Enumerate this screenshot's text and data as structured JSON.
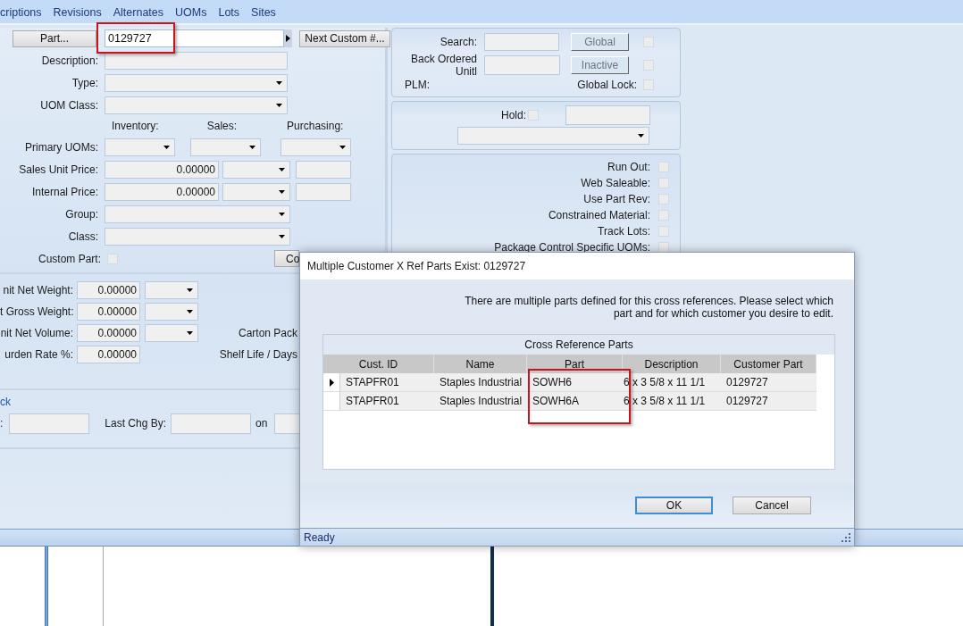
{
  "menu_tabs": [
    "criptions",
    "Revisions",
    "Alternates",
    "UOMs",
    "Lots",
    "Sites"
  ],
  "part_form": {
    "part_button": "Part...",
    "part_number": "0129727",
    "next_button": "Next Custom #...",
    "description_label": "Description:",
    "type_label": "Type:",
    "uom_class_label": "UOM Class:",
    "uom_headers": [
      "Inventory:",
      "Sales:",
      "Purchasing:"
    ],
    "primary_uoms_label": "Primary UOMs:",
    "prices": [
      {
        "label": "Sales Unit Price:",
        "value": "0.00000"
      },
      {
        "label": "Internal Price:",
        "value": "0.00000"
      }
    ],
    "group_label": "Group:",
    "class_label": "Class:",
    "custom_part": {
      "label": "Custom Part:",
      "checked": false
    },
    "partial_button": "Co"
  },
  "measures": [
    {
      "kind": "with_unit",
      "label": "nit Net Weight:",
      "value": "0.00000"
    },
    {
      "kind": "with_unit",
      "label": "t Gross Weight:",
      "value": "0.00000"
    },
    {
      "kind": "with_unit",
      "label": "nit Net Volume:",
      "value": "0.00000",
      "side_label": "Carton Pack"
    },
    {
      "kind": "plain",
      "label": "urden Rate %:",
      "value": "0.00000",
      "side_label": "Shelf Life / Days"
    }
  ],
  "audit": {
    "header": "ck",
    "field_label": ":",
    "last_change_label": "Last Chg By:",
    "on_label": "on"
  },
  "search_panel": {
    "search_label": "Search:",
    "global_button": "Global",
    "global_checked": false,
    "back_ordered_label": "Back Ordered Unitl",
    "inactive_button": "Inactive",
    "inactive_checked": false,
    "plm_label": "PLM:",
    "global_lock": {
      "label": "Global Lock:",
      "checked": false
    }
  },
  "hold": {
    "label": "Hold:",
    "checked": false
  },
  "flags": [
    {
      "label": "Run Out:",
      "checked": false
    },
    {
      "label": "Web Saleable:",
      "checked": false
    },
    {
      "label": "Use Part Rev:",
      "checked": false
    },
    {
      "label": "Constrained Material:",
      "checked": false
    },
    {
      "label": "Track Lots:",
      "checked": false
    },
    {
      "label": "Package Control Specific UOMs:",
      "checked": false
    }
  ],
  "dialog": {
    "title": "Multiple Customer X Ref Parts Exist: 0129727",
    "message": "There are multiple parts defined for this cross references. Please select which part and for which customer you desire to edit.",
    "grid_title": "Cross Reference Parts",
    "columns": [
      "Cust. ID",
      "Name",
      "Part",
      "Description",
      "Customer Part"
    ],
    "rows": [
      {
        "selected": true,
        "cells": [
          "STAPFR01",
          "Staples Industrial",
          "SOWH6",
          "6 x 3 5/8 x 11 1/1",
          "0129727"
        ]
      },
      {
        "selected": false,
        "cells": [
          "STAPFR01",
          "Staples Industrial",
          "SOWH6A",
          "6 x 3 5/8 x 11 1/1",
          "0129727"
        ]
      }
    ],
    "ok_button": "OK",
    "cancel_button": "Cancel",
    "status": "Ready"
  }
}
